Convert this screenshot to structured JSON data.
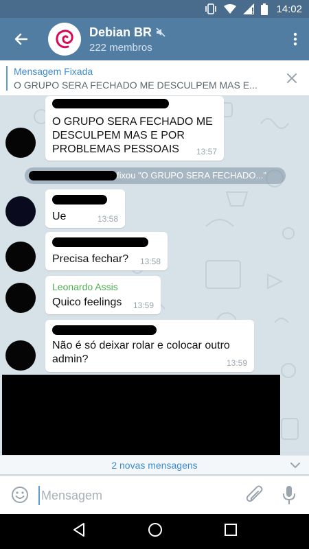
{
  "status": {
    "time": "14:02"
  },
  "header": {
    "title": "Debian BR",
    "subtitle": "222 membros"
  },
  "pinned": {
    "title": "Mensagem Fixada",
    "message": "O GRUPO SERA FECHADO  ME DESCULPEM  MAS E..."
  },
  "messages": [
    {
      "text": "O GRUPO SERA FECHADO  ME DESCULPEM  MAS E POR PROBLEMAS PESSOAIS",
      "time": "13:57"
    },
    {
      "text": "Ue",
      "time": "13:58"
    },
    {
      "text": "Precisa fechar?",
      "time": "13:58"
    },
    {
      "sender": "Leonardo Assis",
      "text": "Quico feelings",
      "time": "13:59"
    },
    {
      "text": "Não é só deixar rolar e colocar outro admin?",
      "time": "13:59"
    }
  ],
  "service": {
    "text": "fixou \"O GRUPO SERA FECHADO...\""
  },
  "new_messages": {
    "label": "2 novas mensagens"
  },
  "input": {
    "placeholder": "Mensagem"
  },
  "colors": {
    "header": "#527da3",
    "statusbar": "#4a6c8c",
    "accent": "#3b8bd0",
    "sender_green": "#4caf50"
  }
}
